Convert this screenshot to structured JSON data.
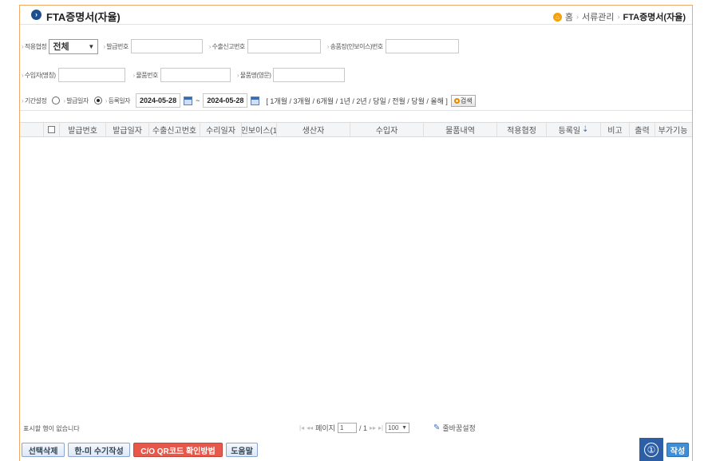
{
  "header": {
    "title": "FTA증명서(자율)",
    "breadcrumb": {
      "home": "홈",
      "section": "서류관리",
      "current": "FTA증명서(자율)"
    }
  },
  "search": {
    "agreement_label": "적용협정",
    "agreement_value": "전체",
    "issue_no_label": "발급번호",
    "export_decl_label": "수출신고번호",
    "invoice_label": "송품장(인보이스)번호",
    "importer_label": "수입자(명칭)",
    "item_no_label": "물품번호",
    "item_name_label": "물품명(영문)",
    "period_label": "기간설정",
    "issue_date_label": "발급일자",
    "reg_date_label": "등록일자",
    "date_from": "2024-05-28",
    "date_sep": "~",
    "date_to": "2024-05-28",
    "periods": "[ 1개월 / 3개월 / 6개월 / 1년 / 2년 / 당일 / 전월 / 당월 / 올해 ]",
    "search_button": "검색"
  },
  "grid": {
    "columns": [
      "발급번호",
      "발급일자",
      "수출신고번호",
      "수리일자",
      "인보이스(1",
      "생산자",
      "수입자",
      "물품내역",
      "적용협정",
      "등록일",
      "비고",
      "출력",
      "부가기능"
    ],
    "sort_marker": "⇣",
    "rows": []
  },
  "footer": {
    "no_rows": "표시할 행이 없습니다",
    "page_label": "페이지",
    "page_value": "1",
    "page_total": "/ 1",
    "page_size": "100",
    "column_settings": "줄바꿈설정"
  },
  "actions": {
    "delete_selected": "선택삭제",
    "manual_write": "한-미 수기작성",
    "qr_check": "C/O QR코드 확인방법",
    "help": "도움말",
    "badge": "①",
    "write": "작성"
  },
  "colors": {
    "frame_border": "#f0a868",
    "primary": "#2d5fa7",
    "danger": "#e8584a",
    "home_icon": "#f2a10a"
  }
}
